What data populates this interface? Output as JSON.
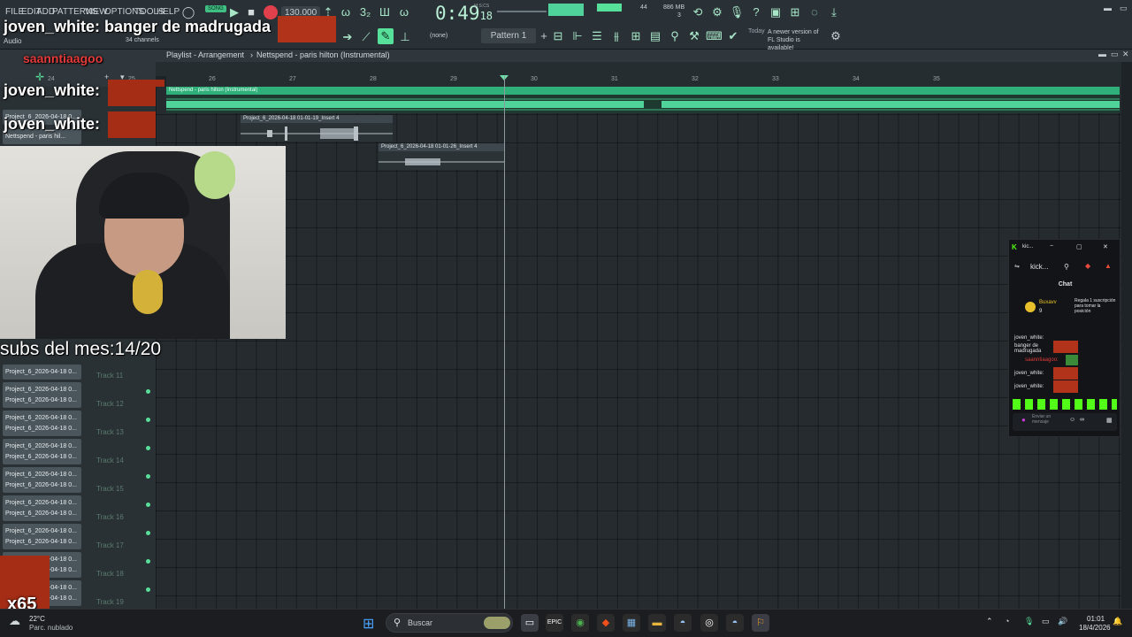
{
  "menu": [
    "FILE",
    "EDIT",
    "ADD",
    "PATTERNS",
    "VIEW",
    "OPTIONS",
    "TOOLS",
    "HELP"
  ],
  "transport": {
    "song_label": "SONG",
    "bpm": "130.000",
    "time_main": "0:49",
    "time_sub": "18",
    "time_unit": "M:S:CS"
  },
  "perf": {
    "cpu": "44",
    "mem": "886 MB",
    "voices": "3"
  },
  "channel_info": {
    "name_overlay": "joven_white: banger de madrugada",
    "type": "Audio",
    "channels": "34 channels"
  },
  "pattern": {
    "none_label": "(none)",
    "pattern_label": "Pattern 1"
  },
  "news": {
    "today": "Today",
    "message": "A newer version of FL Studio is available!"
  },
  "playlist": {
    "breadcrumb_left": "Playlist - Arrangement",
    "breadcrumb_right": "Nettspend - paris hilton (Instrumental)",
    "ruler": [
      {
        "n": "24"
      },
      {
        "n": "25"
      },
      {
        "n": "26"
      },
      {
        "n": "27"
      },
      {
        "n": "28"
      },
      {
        "n": "29"
      },
      {
        "n": "30"
      },
      {
        "n": "31"
      },
      {
        "n": "32"
      },
      {
        "n": "33"
      },
      {
        "n": "34"
      },
      {
        "n": "35"
      }
    ],
    "clips": {
      "main": "Nettspend - paris hilton (Instrumental)",
      "clip2": "Project_6_2026-04-18 01-01-19_Insert 4",
      "clip3": "Project_6_2026-04-18 01-01-26_Insert 4"
    },
    "top_labels": [
      "Project_6_2026-04-18 0...",
      "Nettspend - paris hil..."
    ],
    "tracks": [
      {
        "label": "Project_6_2026-04-18 0...",
        "name": "Track 11"
      },
      {
        "label": "Project_6_2026-04-18 0...",
        "name": "Track 12"
      },
      {
        "label": "Project_6_2026-04-18 0...",
        "name": "Track 13"
      },
      {
        "label": "Project_6_2026-04-18 0...",
        "name": "Track 14"
      },
      {
        "label": "Project_6_2026-04-18 0...",
        "name": "Track 15"
      },
      {
        "label": "Project_6_2026-04-18 0...",
        "name": "Track 16"
      },
      {
        "label": "Project_6_2026-04-18 0...",
        "name": "Track 17"
      },
      {
        "label": "Project_6_2026-04-18 0...",
        "name": "Track 18"
      },
      {
        "label": "Project_6_2026-04-18 0...",
        "name": "Track 19"
      }
    ]
  },
  "overlay": {
    "chat_user1": "saanntiaagoo",
    "chat_user2": "joven_white:",
    "chat_user3": "joven_white:",
    "subs": "subs del mes:14/20",
    "combo": "x65"
  },
  "chat_window": {
    "title": "kic...",
    "url": "kick...",
    "tab": "Chat",
    "gift_user": "Buxavv",
    "gift_count": "9",
    "gift_text": "Regala 1 suscripción para tomar la posición",
    "msgs": [
      {
        "user": "joven_white:",
        "text": "banger de madrugada"
      },
      {
        "user": "saanntiaagoo:",
        "text": ""
      },
      {
        "user": "joven_white:",
        "text": ""
      },
      {
        "user": "joven_white:",
        "text": ""
      }
    ],
    "input_placeholder": "Enviar un mensaje"
  },
  "taskbar": {
    "weather_temp": "22°C",
    "weather_desc": "Parc. nublado",
    "search_placeholder": "Buscar",
    "time": "01:01",
    "date": "18/4/2026"
  },
  "colors": {
    "accent": "#56e09a",
    "waveform": "#4fd39a",
    "record": "#e0404b"
  }
}
